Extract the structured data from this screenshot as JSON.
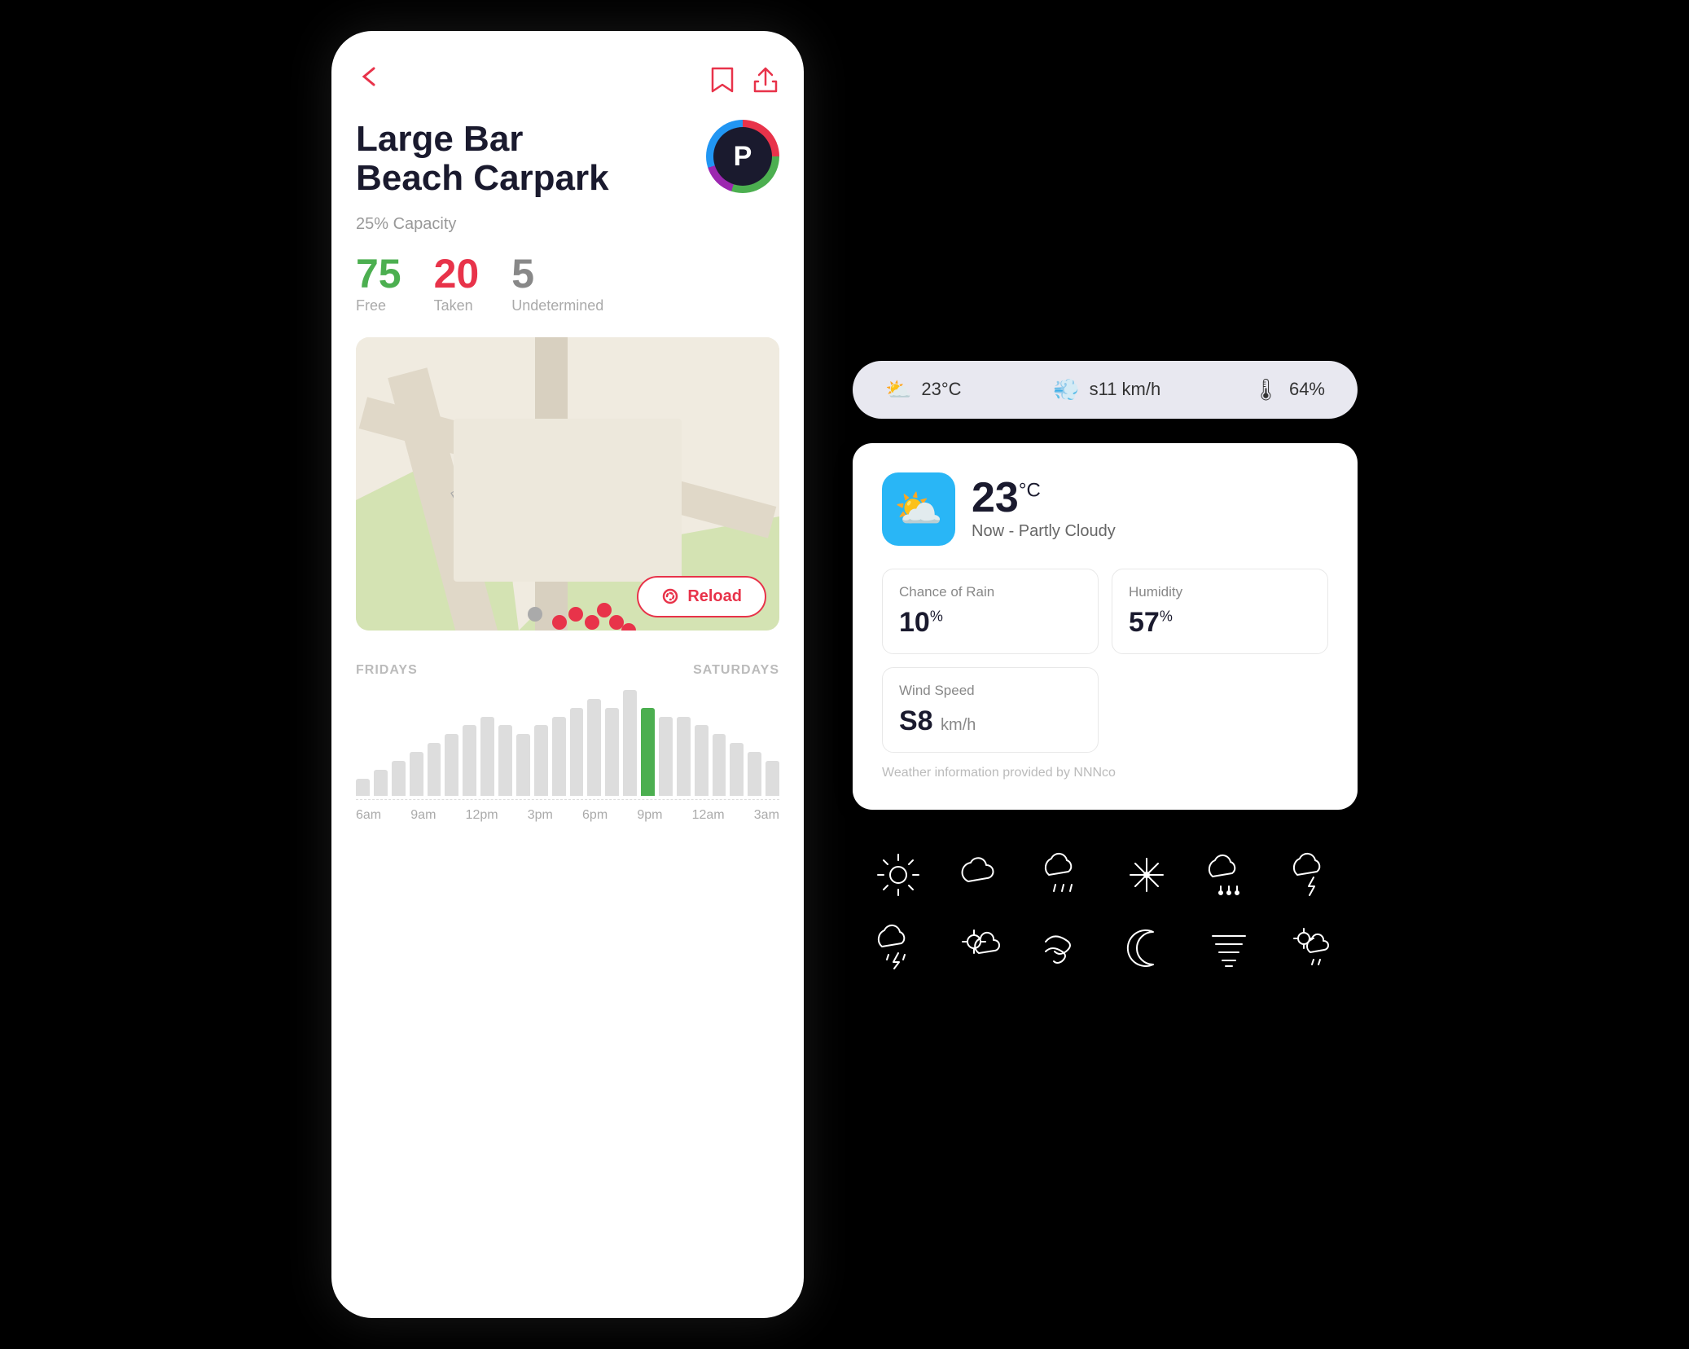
{
  "left": {
    "title": "Large Bar Beach Carpark",
    "capacity": "25% Capacity",
    "stats": {
      "free": "75",
      "free_label": "Free",
      "taken": "20",
      "taken_label": "Taken",
      "undetermined": "5",
      "undetermined_label": "Undetermined"
    },
    "reload_label": "Reload",
    "chart": {
      "fridays_label": "FRIDAYS",
      "saturdays_label": "SATURDAYS",
      "times": [
        "6am",
        "9am",
        "12pm",
        "3pm",
        "6pm",
        "9pm",
        "12am",
        "3am"
      ],
      "bars": [
        1,
        2,
        3,
        4,
        5,
        6,
        7,
        8,
        7,
        6,
        7,
        8,
        9,
        10,
        9,
        11,
        9,
        8,
        8,
        7,
        6,
        5,
        4,
        3
      ]
    }
  },
  "right": {
    "weather_bar": {
      "temp": "23°C",
      "wind": "s11 km/h",
      "humidity": "64%"
    },
    "weather_card": {
      "temperature": "23",
      "temp_unit": "°C",
      "description": "Now - Partly Cloudy",
      "chance_of_rain_label": "Chance of Rain",
      "chance_of_rain_value": "10",
      "chance_of_rain_unit": "%",
      "humidity_label": "Humidity",
      "humidity_value": "57",
      "humidity_unit": "%",
      "wind_speed_label": "Wind Speed",
      "wind_speed_value": "S8",
      "wind_speed_unit": "km/h",
      "attribution": "Weather information provided by NNNco"
    }
  }
}
